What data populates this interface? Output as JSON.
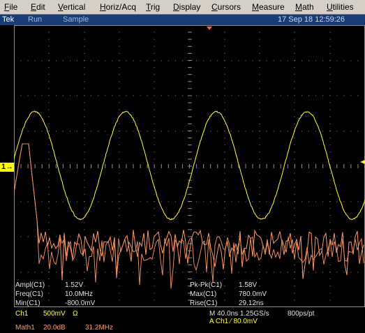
{
  "menu": [
    {
      "label": "File",
      "u": "F",
      "rest": "ile"
    },
    {
      "label": "Edit",
      "u": "E",
      "rest": "dit"
    },
    {
      "label": "Vertical",
      "u": "V",
      "rest": "ertical"
    },
    {
      "label": "Horiz/Acq",
      "u": "H",
      "rest": "oriz/Acq"
    },
    {
      "label": "Trig",
      "u": "T",
      "rest": "rig"
    },
    {
      "label": "Display",
      "u": "D",
      "rest": "isplay"
    },
    {
      "label": "Cursors",
      "u": "C",
      "rest": "ursors"
    },
    {
      "label": "Measure",
      "u": "M",
      "rest": "easure"
    },
    {
      "label": "Math",
      "u": "M",
      "rest": "ath"
    },
    {
      "label": "Utilities",
      "u": "U",
      "rest": "tilities"
    }
  ],
  "status": {
    "brand": "Tek",
    "run_state": "Run",
    "acq_mode": "Sample",
    "datetime": "17 Sep 18 12:59:26"
  },
  "channel_marker": "1",
  "colors": {
    "ch1": "#ffff33",
    "math1": "#ff9966",
    "grid": "#8a8a8a",
    "status_bg": "#1a3c74",
    "trigger": "#ff6633"
  },
  "measurements": {
    "ampl_label": "Ampl(C1)",
    "ampl_value": "1.52V",
    "freq_label": "Freq(C1)",
    "freq_value": "10.0MHz",
    "min_label": "Min(C1)",
    "min_value": "-800.0mV",
    "pkpk_label": "Pk-Pk(C1)",
    "pkpk_value": "1.58V",
    "max_label": "Max(C1)",
    "max_value": "780.0mV",
    "rise_label": "Rise(C1)",
    "rise_value": "29.12ns"
  },
  "readout": {
    "ch1_label": "Ch1",
    "ch1_scale": "500mV",
    "ch1_coupling": "Ω",
    "math1_label": "Math1",
    "math1_scale": "20.0dB",
    "math1_freq": "31.2MHz",
    "timebase": "M 40.0ns 1.25GS/s",
    "record": "800ps/pt",
    "trigger": "A  Ch1  ⁄  80.0mV"
  }
}
